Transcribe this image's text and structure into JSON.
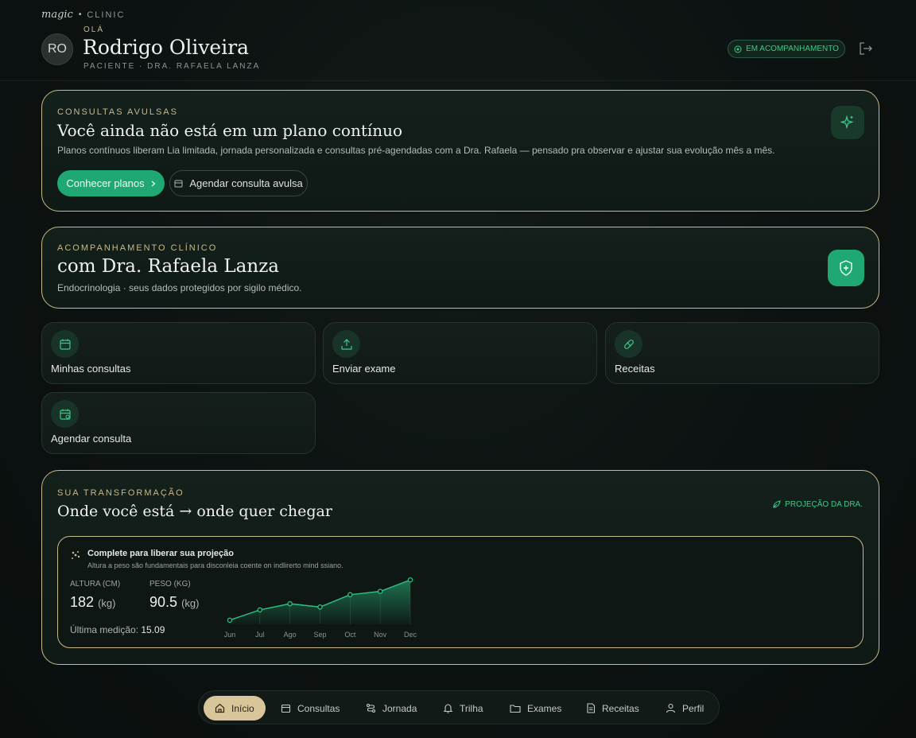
{
  "brand": {
    "name": "magic",
    "separator": "•",
    "suffix": "CLINIC"
  },
  "user": {
    "initials": "RO",
    "greeting": "OLÁ",
    "name": "Rodrigo Oliveira",
    "subtitle": "PACIENTE · DRA. RAFAELA LANZA"
  },
  "status": {
    "label": "EM ACOMPANHAMENTO",
    "color": "#3ec98a"
  },
  "plans_card": {
    "eyebrow": "CONSULTAS AVULSAS",
    "title": "Você ainda não está em um plano contínuo",
    "description": "Planos contínuos liberam Lia limitada, jornada personalizada e consultas pré-agendadas com a Dra. Rafaela — pensado pra observar e ajustar sua evolução mês a mês.",
    "primary_button": "Conhecer planos",
    "secondary_button": "Agendar consulta avulsa"
  },
  "clinical_card": {
    "eyebrow": "ACOMPANHAMENTO CLÍNICO",
    "title": "com Dra. Rafaela Lanza",
    "description": "Endocrinologia · seus dados protegidos por sigilo médico."
  },
  "tiles": [
    {
      "label": "Minhas consultas",
      "icon": "calendar-icon"
    },
    {
      "label": "Enviar exame",
      "icon": "upload-icon"
    },
    {
      "label": "Receitas",
      "icon": "pill-icon"
    },
    {
      "label": "Agendar consulta",
      "icon": "calendar-clock-icon"
    }
  ],
  "transformation": {
    "eyebrow": "SUA TRANSFORMAÇÃO",
    "title": "Onde você está → onde quer chegar",
    "projection_label": "PROJEÇÃO DA DRA.",
    "inner": {
      "title": "Complete para liberar sua projeção",
      "description": "Altura a peso são fundamentais para disconleia coente on indlirerto mind ssiano.",
      "height_label": "ALTURA (CM)",
      "height_value": "182",
      "height_unit": "(kg)",
      "weight_label": "PESO (KG)",
      "weight_value": "90.5",
      "weight_unit": "(kg)",
      "last_measure_label": "Última medição:",
      "last_measure_value": "15.09"
    }
  },
  "chart_data": {
    "type": "area",
    "categories": [
      "Jun",
      "Jul",
      "Ago",
      "Sep",
      "Oct",
      "Nov",
      "Dec"
    ],
    "values": [
      1,
      3.5,
      5,
      4.2,
      7.2,
      8,
      10.8
    ],
    "ylim": [
      0,
      12
    ],
    "grid": false,
    "color": "#2bbf82"
  },
  "nav": [
    {
      "label": "Início",
      "icon": "home-icon",
      "active": true
    },
    {
      "label": "Consultas",
      "icon": "calendar-icon",
      "active": false
    },
    {
      "label": "Jornada",
      "icon": "route-icon",
      "active": false
    },
    {
      "label": "Trilha",
      "icon": "bell-icon",
      "active": false
    },
    {
      "label": "Exames",
      "icon": "folder-icon",
      "active": false
    },
    {
      "label": "Receitas",
      "icon": "document-icon",
      "active": false
    },
    {
      "label": "Perfil",
      "icon": "user-icon",
      "active": false
    }
  ]
}
